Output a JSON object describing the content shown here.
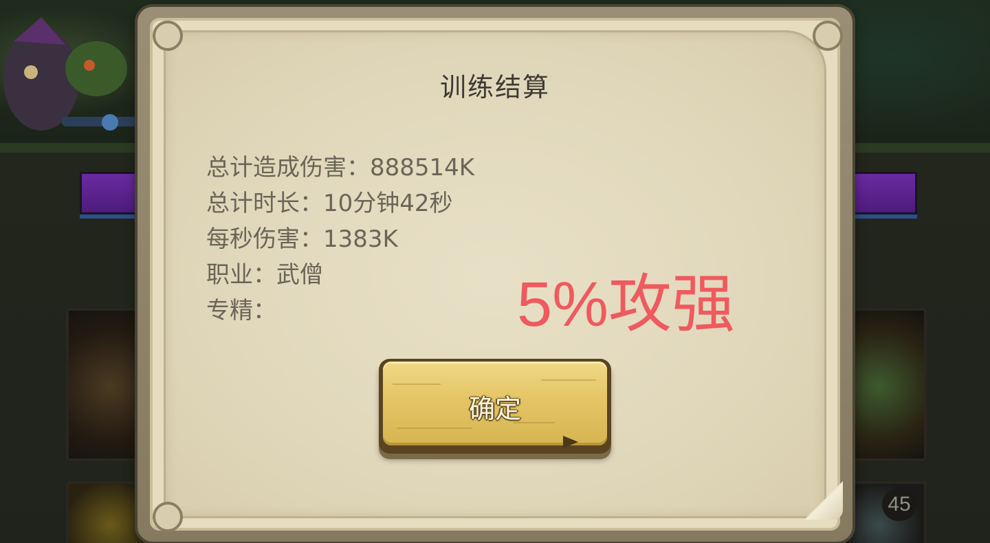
{
  "dialog": {
    "title": "训练结算",
    "stats": [
      {
        "label": "总计造成伤害：",
        "value": "888514K"
      },
      {
        "label": "总计时长：",
        "value": "10分钟42秒"
      },
      {
        "label": "每秒伤害：",
        "value": "1383K"
      },
      {
        "label": "职业：",
        "value": "武僧"
      },
      {
        "label": "专精：",
        "value": ""
      }
    ],
    "confirm_label": "确定"
  },
  "annotation": {
    "text": "5%攻强",
    "color": "#ef5a5e"
  },
  "background": {
    "level_badge": "45"
  },
  "colors": {
    "button": "#e4c566",
    "parchment": "#e1d8bc",
    "purple_bar": "#6a2aa0"
  }
}
